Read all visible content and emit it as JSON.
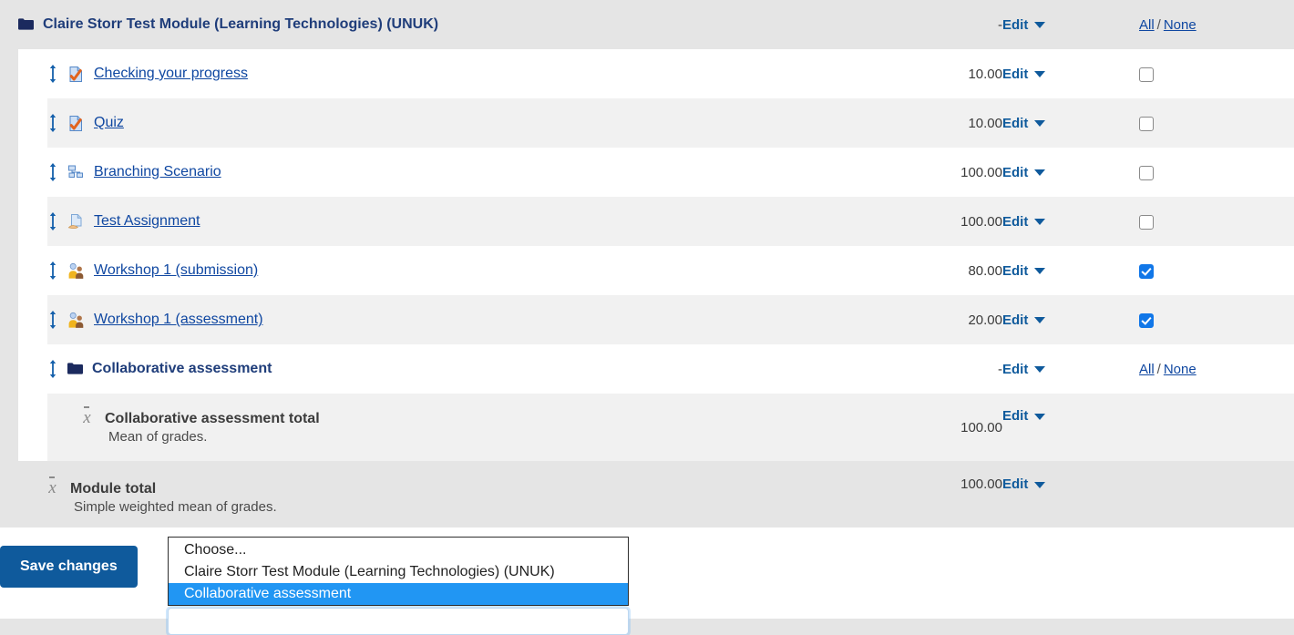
{
  "table": {
    "rows": [
      {
        "kind": "category-header",
        "icon": "folder-icon",
        "name": "Claire Storr Test Module (Learning Technologies) (UNUK)",
        "weight": "-",
        "edit_label": "Edit",
        "select_all_label": "All",
        "select_sep": "/",
        "select_none_label": "None"
      },
      {
        "kind": "item",
        "icon": "quiz-icon",
        "name": "Checking your progress",
        "weight": "10.00",
        "edit_label": "Edit",
        "checked": false
      },
      {
        "kind": "item",
        "icon": "quiz-icon",
        "name": "Quiz",
        "weight": "10.00",
        "edit_label": "Edit",
        "checked": false
      },
      {
        "kind": "item",
        "icon": "lesson-icon",
        "name": "Branching Scenario",
        "weight": "100.00",
        "edit_label": "Edit",
        "checked": false
      },
      {
        "kind": "item",
        "icon": "assignment-icon",
        "name": "Test Assignment",
        "weight": "100.00",
        "edit_label": "Edit",
        "checked": false
      },
      {
        "kind": "item",
        "icon": "workshop-icon",
        "name": "Workshop 1 (submission)",
        "weight": "80.00",
        "edit_label": "Edit",
        "checked": true
      },
      {
        "kind": "item",
        "icon": "workshop-icon",
        "name": "Workshop 1 (assessment)",
        "weight": "20.00",
        "edit_label": "Edit",
        "checked": true
      },
      {
        "kind": "subcategory",
        "icon": "folder-icon",
        "name": "Collaborative assessment",
        "weight": "-",
        "edit_label": "Edit",
        "select_all_label": "All",
        "select_sep": "/",
        "select_none_label": "None"
      },
      {
        "kind": "category-total",
        "icon": "mean-icon",
        "name": "Collaborative assessment total",
        "description": "Mean of grades.",
        "weight": "100.00",
        "edit_label": "Edit"
      },
      {
        "kind": "module-total",
        "icon": "mean-icon",
        "name": "Module total",
        "description": "Simple weighted mean of grades.",
        "weight": "100.00",
        "edit_label": "Edit"
      }
    ]
  },
  "bottom": {
    "save_label": "Save changes",
    "dropdown": {
      "options": [
        {
          "label": "Choose...",
          "selected": false
        },
        {
          "label": "Claire Storr Test Module (Learning Technologies) (UNUK)",
          "selected": false
        },
        {
          "label": "Collaborative assessment",
          "selected": true
        }
      ],
      "field_value": ""
    }
  },
  "colors": {
    "link": "#0f47a1",
    "edit_link": "#0f5a9c",
    "primary_button": "#0f5a9c",
    "selected_option": "#2196f3",
    "checkbox_checked": "#1177e8",
    "row_shade": "#f1f1f1",
    "header_shade": "#e5e5e5"
  }
}
